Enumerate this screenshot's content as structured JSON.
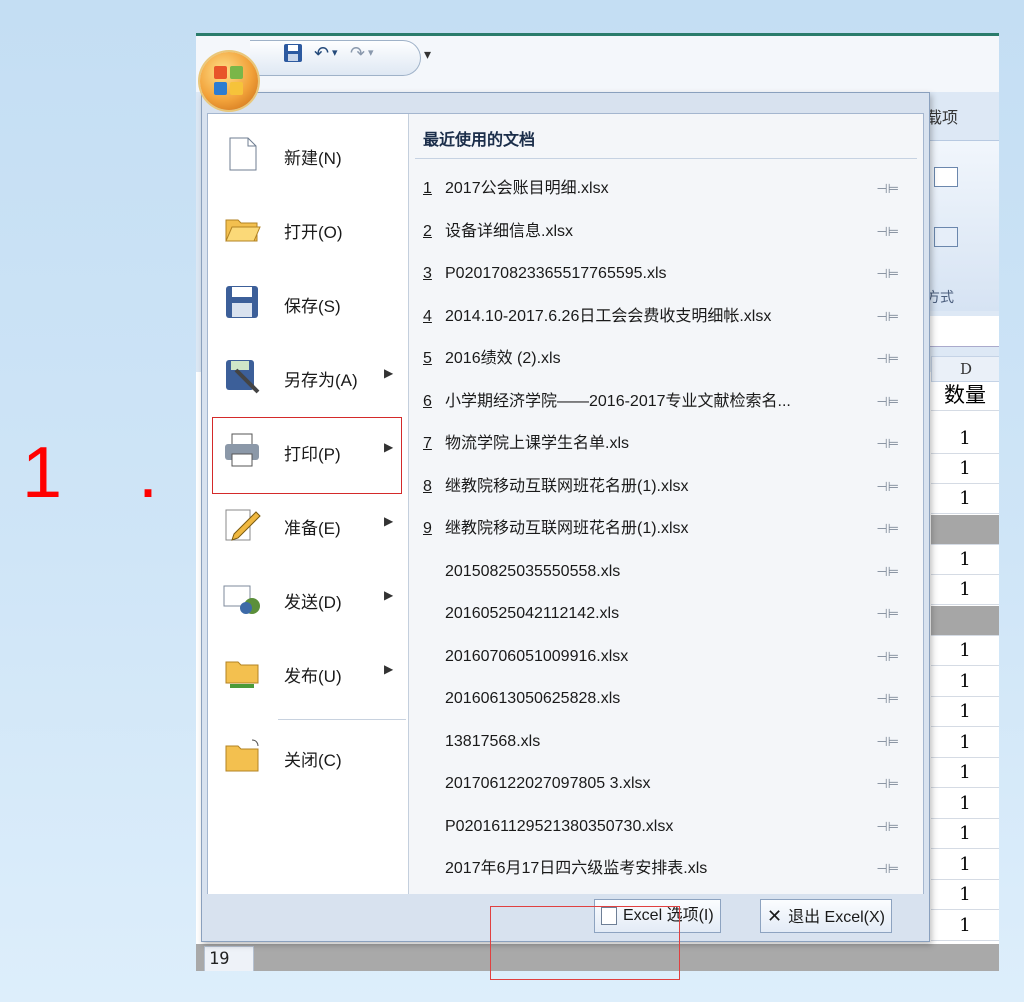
{
  "step_label": "1 .",
  "qat": {
    "dropdown": "▾"
  },
  "ribbon": {
    "tab_partial": "载项",
    "group_partial": "方式",
    "colD": "D",
    "header_cell": "数量"
  },
  "sheet_values": [
    "1",
    "1",
    "1",
    "",
    "1",
    "1",
    "",
    "1",
    "1",
    "1",
    "1",
    "1",
    "1",
    "1",
    "1",
    "1",
    "1"
  ],
  "row19": "19",
  "left_menu": [
    {
      "label": "新建(N)",
      "icon": "new-document-icon",
      "arrow": ""
    },
    {
      "label": "打开(O)",
      "icon": "open-folder-icon",
      "arrow": ""
    },
    {
      "label": "保存(S)",
      "icon": "floppy-disk-icon",
      "arrow": ""
    },
    {
      "label": "另存为(A)",
      "icon": "save-as-icon",
      "arrow": "▶"
    },
    {
      "label": "打印(P)",
      "icon": "printer-icon",
      "arrow": "▶"
    },
    {
      "label": "准备(E)",
      "icon": "prepare-pencil-icon",
      "arrow": "▶"
    },
    {
      "label": "发送(D)",
      "icon": "send-mail-icon",
      "arrow": "▶"
    },
    {
      "label": "发布(U)",
      "icon": "publish-folder-icon",
      "arrow": "▶"
    },
    {
      "label": "关闭(C)",
      "icon": "close-folder-icon",
      "arrow": ""
    }
  ],
  "recent": {
    "title": "最近使用的文档",
    "items": [
      {
        "num": "1",
        "name": "2017公会账目明细.xlsx"
      },
      {
        "num": "2",
        "name": "设备详细信息.xlsx"
      },
      {
        "num": "3",
        "name": "P020170823365517765595.xls"
      },
      {
        "num": "4",
        "name": "2014.10-2017.6.26日工会会费收支明细帐.xlsx"
      },
      {
        "num": "5",
        "name": "2016绩效 (2).xls"
      },
      {
        "num": "6",
        "name": "小学期经济学院——2016-2017专业文献检索名..."
      },
      {
        "num": "7",
        "name": "物流学院上课学生名单.xls"
      },
      {
        "num": "8",
        "name": "继教院移动互联网班花名册(1).xlsx"
      },
      {
        "num": "9",
        "name": "继教院移动互联网班花名册(1).xlsx"
      },
      {
        "num": "",
        "name": "20150825035550558.xls"
      },
      {
        "num": "",
        "name": "20160525042112142.xls"
      },
      {
        "num": "",
        "name": "20160706051009916.xlsx"
      },
      {
        "num": "",
        "name": "20160613050625828.xls"
      },
      {
        "num": "",
        "name": "13817568.xls"
      },
      {
        "num": "",
        "name": "201706122027097805 3.xlsx"
      },
      {
        "num": "",
        "name": "P020161129521380350730.xlsx"
      },
      {
        "num": "",
        "name": "2017年6月17日四六级监考安排表.xls"
      }
    ],
    "pin": "⊣⊨"
  },
  "footer": {
    "options": "Excel 选项(I)",
    "exit": "退出 Excel(X)",
    "exit_icon": "✕"
  }
}
